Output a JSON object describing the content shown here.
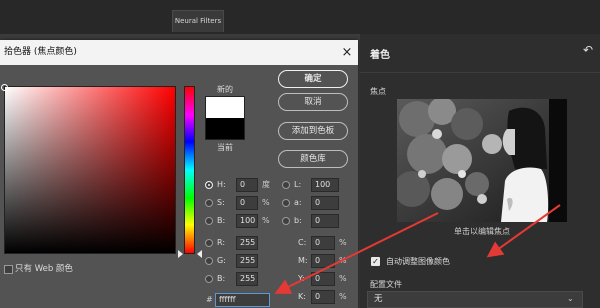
{
  "background": {
    "tab_neural_filters": "Neural Filters"
  },
  "dialog": {
    "title": "拾色器 (焦点颜色)",
    "close_glyph": "×",
    "new_label": "新的",
    "current_label": "当前",
    "buttons": {
      "ok": "确定",
      "cancel": "取消",
      "add_to_swatches": "添加到色板",
      "color_libraries": "颜色库"
    },
    "web_only_label": "只有 Web 颜色",
    "hsb": {
      "h_label": "H:",
      "h_value": "0",
      "h_unit": "度",
      "s_label": "S:",
      "s_value": "0",
      "s_unit": "%",
      "b_label": "B:",
      "b_value": "100",
      "b_unit": "%"
    },
    "rgb": {
      "r_label": "R:",
      "r_value": "255",
      "g_label": "G:",
      "g_value": "255",
      "b_label": "B:",
      "b_value": "255"
    },
    "lab": {
      "l_label": "L:",
      "l_value": "100",
      "a_label": "a:",
      "a_value": "0",
      "b_label": "b:",
      "b_value": "0"
    },
    "cmyk": {
      "c_label": "C:",
      "c_value": "0",
      "c_unit": "%",
      "m_label": "M:",
      "m_value": "0",
      "m_unit": "%",
      "y_label": "Y:",
      "y_value": "0",
      "y_unit": "%",
      "k_label": "K:",
      "k_value": "0",
      "k_unit": "%"
    },
    "hex_label": "#",
    "hex_value": "ffffff",
    "new_color": "#ffffff",
    "current_color": "#000000"
  },
  "panel": {
    "title": "着色",
    "undo_icon": "↶",
    "focus_label": "焦点",
    "photo_caption": "单击以编辑焦点",
    "auto_adjust_label": "自动调整图像颜色",
    "auto_adjust_checked": "✓",
    "profile_label": "配置文件",
    "profile_value": "无",
    "profile_chevron": "⌄"
  },
  "annotation_color": "#e53935"
}
